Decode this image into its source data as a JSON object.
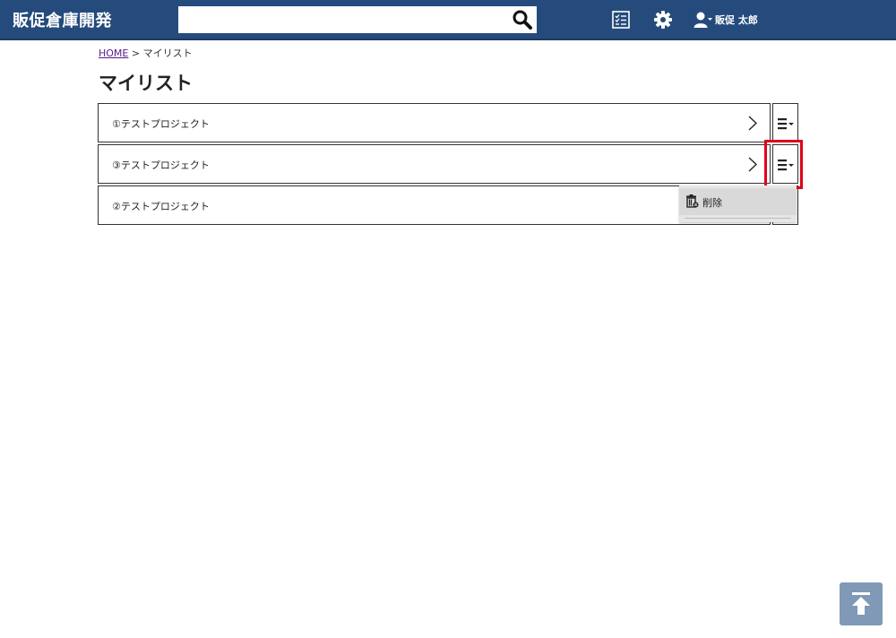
{
  "header": {
    "app_title": "販促倉庫開発",
    "search": {
      "value": "",
      "placeholder": ""
    },
    "user_name": "販促 太郎"
  },
  "breadcrumb": {
    "home": "HOME",
    "separator": ">",
    "current": "マイリスト"
  },
  "page_title": "マイリスト",
  "projects": [
    {
      "label": "①テストプロジェクト"
    },
    {
      "label": "③テストプロジェクト"
    },
    {
      "label": "②テストプロジェクト"
    }
  ],
  "dropdown": {
    "items": [
      {
        "label": "削除",
        "icon": "trash-icon"
      }
    ]
  },
  "icons": {
    "search": "search-icon",
    "checklist": "checklist-icon",
    "settings": "gear-icon",
    "user": "user-icon",
    "row_arrow": "chevron-right-icon",
    "row_menu": "hamburger-menu-icon",
    "back_to_top": "arrow-up-to-top-icon"
  },
  "colors": {
    "header_bg": "#254b7c",
    "highlight": "#e0001b",
    "to_top_bg": "#8099b6"
  }
}
